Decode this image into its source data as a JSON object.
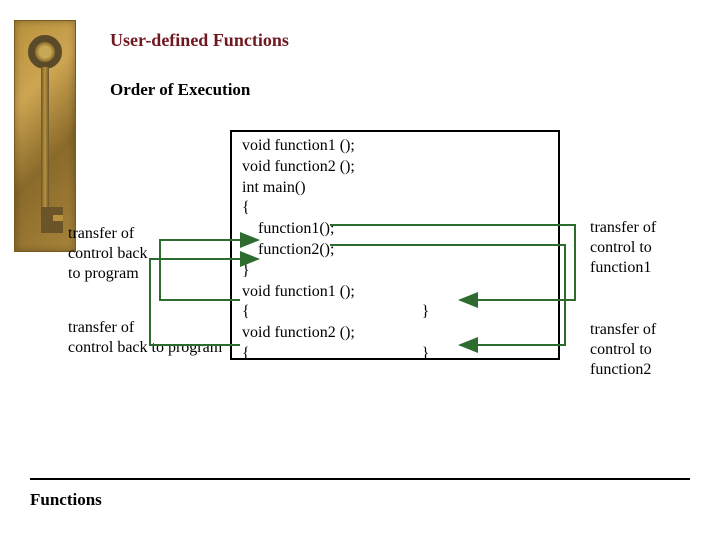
{
  "header": {
    "title": "User-defined Functions",
    "subtitle": "Order of Execution"
  },
  "code": "void function1 ();\nvoid function2 ();\nint main()\n{\n    function1();\n    function2();\n}\nvoid function1 ();\n{                                           }\nvoid function2 ();\n{                                           }",
  "labels": {
    "left1": "transfer of\ncontrol back\nto program",
    "left2": "transfer of\ncontrol back to program",
    "right1": "transfer of\ncontrol to\nfunction1",
    "right2": "transfer of\ncontrol to\nfunction2"
  },
  "footer": "Functions"
}
